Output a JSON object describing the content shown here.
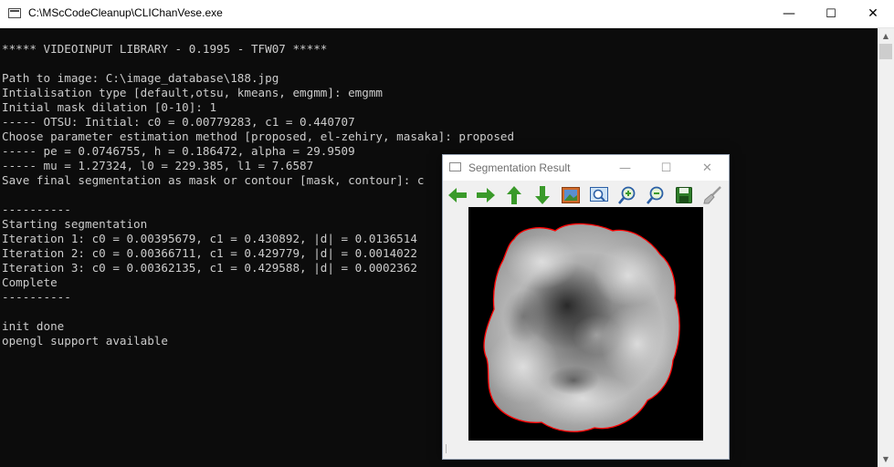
{
  "window": {
    "title": "C:\\MScCodeCleanup\\CLIChanVese.exe",
    "minimize": "—",
    "maximize": "☐",
    "close": "✕"
  },
  "console": {
    "lines": [
      "***** VIDEOINPUT LIBRARY - 0.1995 - TFW07 *****",
      "",
      "Path to image: C:\\image_database\\188.jpg",
      "Intialisation type [default,otsu, kmeans, emgmm]: emgmm",
      "Initial mask dilation [0-10]: 1",
      "----- OTSU: Initial: c0 = 0.00779283, c1 = 0.440707",
      "Choose parameter estimation method [proposed, el-zehiry, masaka]: proposed",
      "----- pe = 0.0746755, h = 0.186472, alpha = 29.9509",
      "----- mu = 1.27324, l0 = 229.385, l1 = 7.6587",
      "Save final segmentation as mask or contour [mask, contour]: c",
      "",
      "----------",
      "Starting segmentation",
      "Iteration 1: c0 = 0.00395679, c1 = 0.430892, |d| = 0.0136514",
      "Iteration 2: c0 = 0.00366711, c1 = 0.429779, |d| = 0.0014022",
      "Iteration 3: c0 = 0.00362135, c1 = 0.429588, |d| = 0.0002362",
      "Complete",
      "----------",
      "",
      "init done",
      "opengl support available"
    ]
  },
  "segmentation_window": {
    "title": "Segmentation Result",
    "toolbar": [
      "arrow-left-icon",
      "arrow-right-icon",
      "arrow-up-icon",
      "arrow-down-icon",
      "image-icon",
      "zoom-fit-icon",
      "zoom-in-icon",
      "zoom-out-icon",
      "save-icon",
      "brush-icon"
    ]
  },
  "colors": {
    "console_bg": "#0c0c0c",
    "console_text": "#cccccc",
    "contour": "#ff0000",
    "toolbar_green": "#3a9a2a",
    "toolbar_blue": "#2b5fa6"
  }
}
